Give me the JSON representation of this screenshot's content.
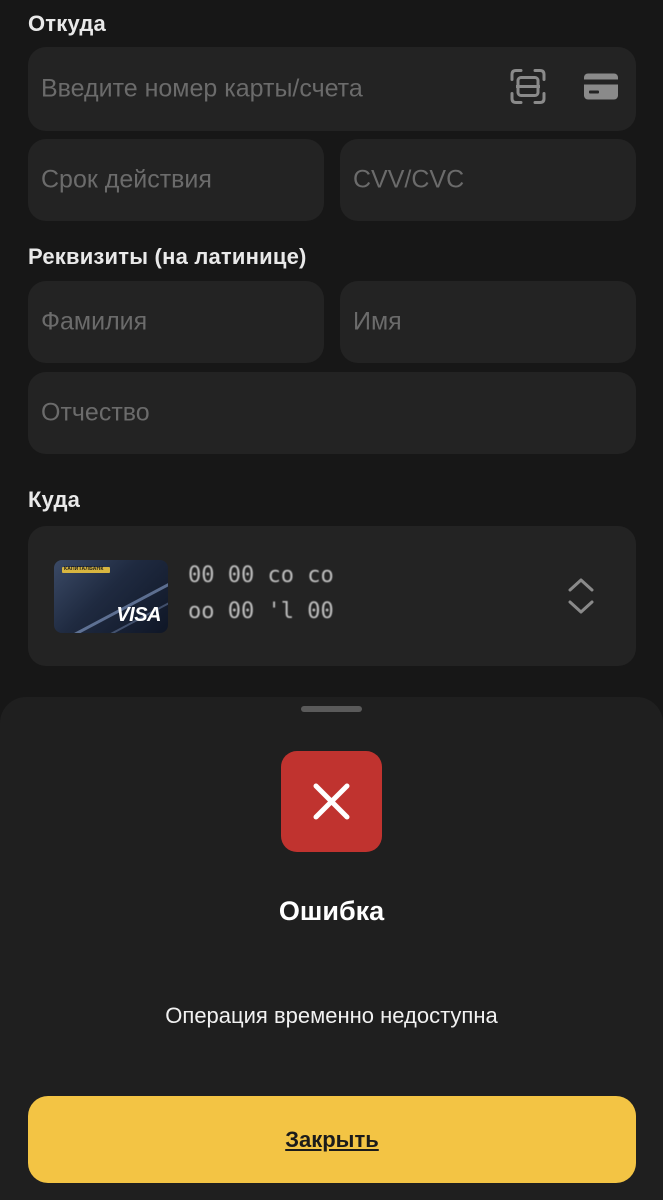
{
  "from_section": {
    "label": "Откуда",
    "card_number_placeholder": "Введите номер карты/счета",
    "scan_icon": "scan-card-icon",
    "card_icon": "card-icon",
    "expiry_placeholder": "Срок действия",
    "cvv_placeholder": "CVV/CVC"
  },
  "details_section": {
    "label": "Реквизиты (на латинице)",
    "last_name_placeholder": "Фамилия",
    "first_name_placeholder": "Имя",
    "middle_name_placeholder": "Отчество"
  },
  "to_section": {
    "label": "Куда",
    "card": {
      "bank_name": "КАПИТАЛБАНК",
      "network": "VISA",
      "masked_number_line1": "00 00 co co",
      "masked_number_line2": "oo 00 'l 00 oo"
    },
    "selector_icon": "chevron-up-down-icon"
  },
  "error_sheet": {
    "icon": "close-x-icon",
    "title": "Ошибка",
    "message": "Операция временно недоступна",
    "close_label": "Закрыть"
  },
  "colors": {
    "background": "#171717",
    "field": "#232323",
    "sheet": "#1f1f1f",
    "error_red": "#c0332f",
    "accent_yellow": "#f3c444"
  }
}
